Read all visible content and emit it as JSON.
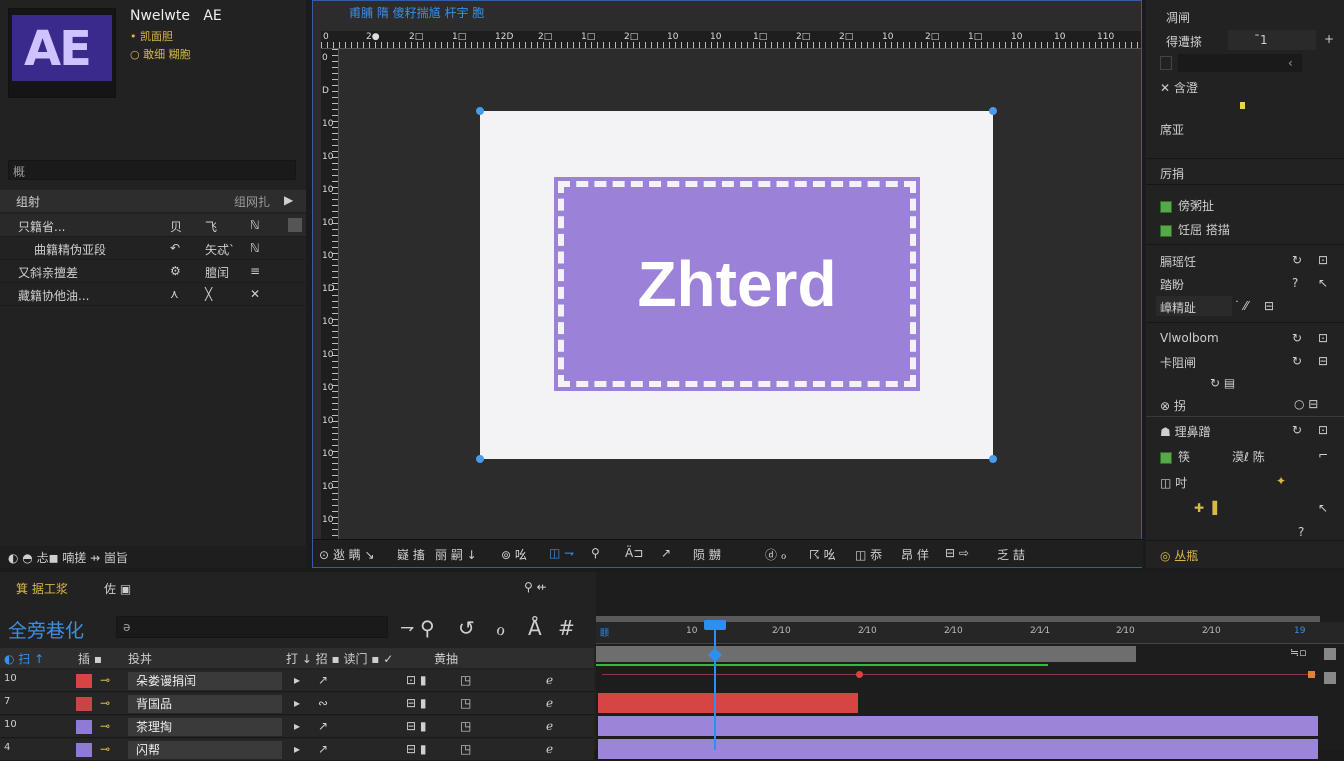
{
  "project": {
    "app_name": "Nwelwte",
    "app_short": "AE",
    "logo_text": "AE",
    "line1": "• 凯面胆",
    "line2": "○ 敢细 糊胞",
    "search_placeholder": "概",
    "header": {
      "label": "组射",
      "right": "组网扎",
      "arrow": "▶"
    },
    "rows": [
      {
        "name": "只籍省...",
        "c1": "贝",
        "c2": "飞",
        "c3": "ℕ"
      },
      {
        "name": "曲籍精伪亚段",
        "c1": "↶",
        "c2": "矢忒`",
        "c3": "ℕ"
      },
      {
        "name": "又斜亲擅差",
        "c1": "⚙",
        "c2": "膻闰",
        "c3": "≡"
      },
      {
        "name": "藏籍协他油...",
        "c1": "⋏",
        "c2": "╳",
        "c3": "✕"
      }
    ],
    "footer": "◐ ◓ 忐◼ 喃搓   ⇸   崮旨"
  },
  "comp": {
    "title": "甫脯 隋 傻籽揣馗 杆宇 胞",
    "ruler_ticks": [
      "0",
      "2●",
      "2□",
      "1□",
      "12D",
      "2□",
      "1□",
      "2□",
      "10",
      "10",
      "1□",
      "2□",
      "2□",
      "10",
      "2□",
      "1□",
      "10",
      "10",
      "110"
    ],
    "ruler_left_ticks": [
      "0",
      "D",
      "10",
      "10",
      "10",
      "10",
      "10",
      "1D",
      "10",
      "10",
      "10",
      "10",
      "10",
      "10",
      "10"
    ],
    "canvas_text": "Zhterd",
    "toolbar": [
      "⊙ 逖 瞒 ↘",
      "嶷 搐",
      "丽 嗣 ↓",
      "⊚ 吆",
      "◫ ⇁",
      "⚲",
      "Ä⊐",
      "↗",
      "陨 嬲",
      "ⓓ ℴ",
      "☈ 吆",
      "◫ 忝",
      "昂 佯",
      "⊟ ⇨",
      "乏 喆"
    ]
  },
  "props": {
    "r0": "凋闸",
    "r1": "得遭搽",
    "r1_val": "¯1",
    "r2_val": "‹",
    "r3": "✕ 含澄",
    "r4": "席亚",
    "sec1": "厉捐",
    "chk1": "傍粥扯",
    "chk2": "饪屈 搭描",
    "rows_a": [
      {
        "lbl": "膈瑶饪",
        "v1": "↻",
        "v2": "⊡"
      },
      {
        "lbl": "踏盼",
        "v1": "?",
        "v2": "↖"
      },
      {
        "lbl": "嶂精趾",
        "v1": "˙ ⁄⁄",
        "v2": "⊟"
      }
    ],
    "rows_b": [
      {
        "lbl": "Vlwolbom",
        "v1": "↻",
        "v2": "⊡"
      },
      {
        "lbl": "卡阻闸",
        "v1": "↻",
        "v2": "⊟"
      }
    ],
    "mid_icons": "↻   ▤",
    "r_cat": "⊗ 拐",
    "r_cat_v": "○ ⊟",
    "rows_c": [
      {
        "lbl": "☗ 理鼻蹭",
        "v1": "↻",
        "v2": "⊡"
      },
      {
        "lbl": "筷",
        "v1": "漠ℓ 陈",
        "v2": "⌐"
      },
      {
        "lbl": "◫ 吋",
        "v1": "✦",
        "v2": ""
      }
    ],
    "plus_row": "✚ ▐",
    "q1": "↖",
    "q2": "?",
    "footer": "◎ 丛瓶"
  },
  "timeline": {
    "title": "箕 据工浆",
    "title_icons": "佐   ▣",
    "title_right": "⚲  ⇷",
    "comp_name": "全旁巷化",
    "search_placeholder": "ə",
    "tools": [
      "⇁",
      "⚲",
      "↺",
      "ℴ",
      "Å",
      "#"
    ],
    "header": [
      "◐ 扫 ↑",
      "插 ▪",
      "投丼",
      "打 ↓ 招 ▪ 读门 ▪ ✓",
      "黄抽"
    ],
    "layers": [
      {
        "num": "10",
        "color": "#d84444",
        "name": "朵娄谩捐闰",
        "sw": "↗",
        "q": "⊡ ▮",
        "lk": "◳"
      },
      {
        "num": "7",
        "color": "#c84545",
        "name": "背国品",
        "sw": "∾",
        "q": "⊟ ▮",
        "lk": "◳"
      },
      {
        "num": "10",
        "color": "#8f7bd6",
        "name": "茶理掏",
        "sw": "↗",
        "q": "⊟ ▮",
        "lk": "◳"
      },
      {
        "num": "4",
        "color": "#8f7bd6",
        "name": "闪帮",
        "sw": "↗",
        "q": "⊟ ▮",
        "lk": "◳"
      }
    ],
    "ruler": [
      "颐",
      "10",
      "2⁄10",
      "2⁄10",
      "2⁄10",
      "2⁄1⁄1",
      "2⁄10",
      "2⁄10",
      "19"
    ],
    "colors": {
      "red": "#d64444",
      "purple": "#9a85d9",
      "playhead": "#2f8ff0",
      "green": "#2ebd3a"
    }
  }
}
